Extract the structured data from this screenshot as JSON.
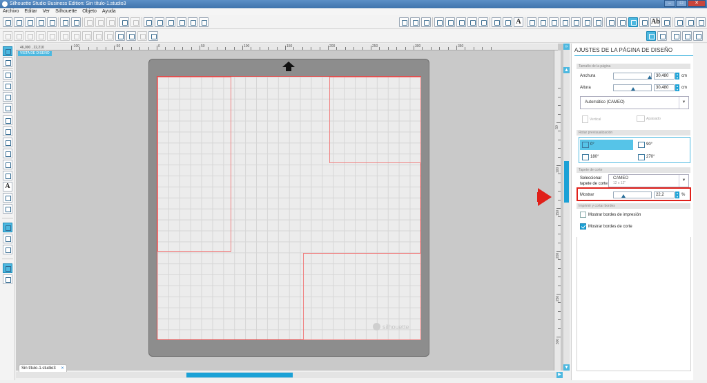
{
  "window": {
    "title": "Silhouette Studio Business Edition: Sin título-1.studio3",
    "min": "–",
    "max": "□",
    "close": "✕"
  },
  "menu": [
    "Archivo",
    "Editar",
    "Ver",
    "Silhouette",
    "Objeto",
    "Ayuda"
  ],
  "ruler": {
    "coord_readout": "46,000 , 22,210",
    "h_labels": [
      "-100",
      "-50",
      "0",
      "50",
      "100",
      "150",
      "200",
      "250",
      "300",
      "350"
    ],
    "v_labels": [
      "50",
      "100",
      "150",
      "200",
      "250",
      "300"
    ]
  },
  "canvas": {
    "view_tag": "VISTA DE DISEÑO",
    "watermark": "silhouette"
  },
  "document_tab": {
    "label": "Sin título-1.studio3",
    "close": "✕"
  },
  "panel": {
    "title": "AJUSTES DE LA PÁGINA DE DISEÑO",
    "page_size": {
      "section": "Tamaño de la página",
      "width_label": "Anchura",
      "width_value": "30,480",
      "height_label": "Altura",
      "height_value": "30,480",
      "unit": "cm",
      "preset": "Automático (CAMEO)",
      "vertical": "Vertical",
      "landscape": "Apaisado"
    },
    "rotate": {
      "section": "Rotar previsualización",
      "options": [
        "0°",
        "90°",
        "180°",
        "270°"
      ],
      "selected": "0°"
    },
    "mat": {
      "section": "Tapete de corte",
      "select_label_1": "Seleccionar",
      "select_label_2": "tapete de corte",
      "mat_value": "CAMEO",
      "mat_sub": "12 x 12\"",
      "show_label": "Mostrar",
      "show_value": "22,2",
      "show_unit": "%",
      "show_fraction": 0.22
    },
    "borders": {
      "section": "Imprimir y cortar bordes",
      "print_label": "Mostrar bordes de impresión",
      "print_checked": false,
      "cut_label": "Mostrar bordes de corte",
      "cut_checked": true
    }
  },
  "colors": {
    "accent": "#1ba1d6",
    "highlight": "#e0201a",
    "mat": "#8d8d8d",
    "cut_border": "#e04848"
  }
}
